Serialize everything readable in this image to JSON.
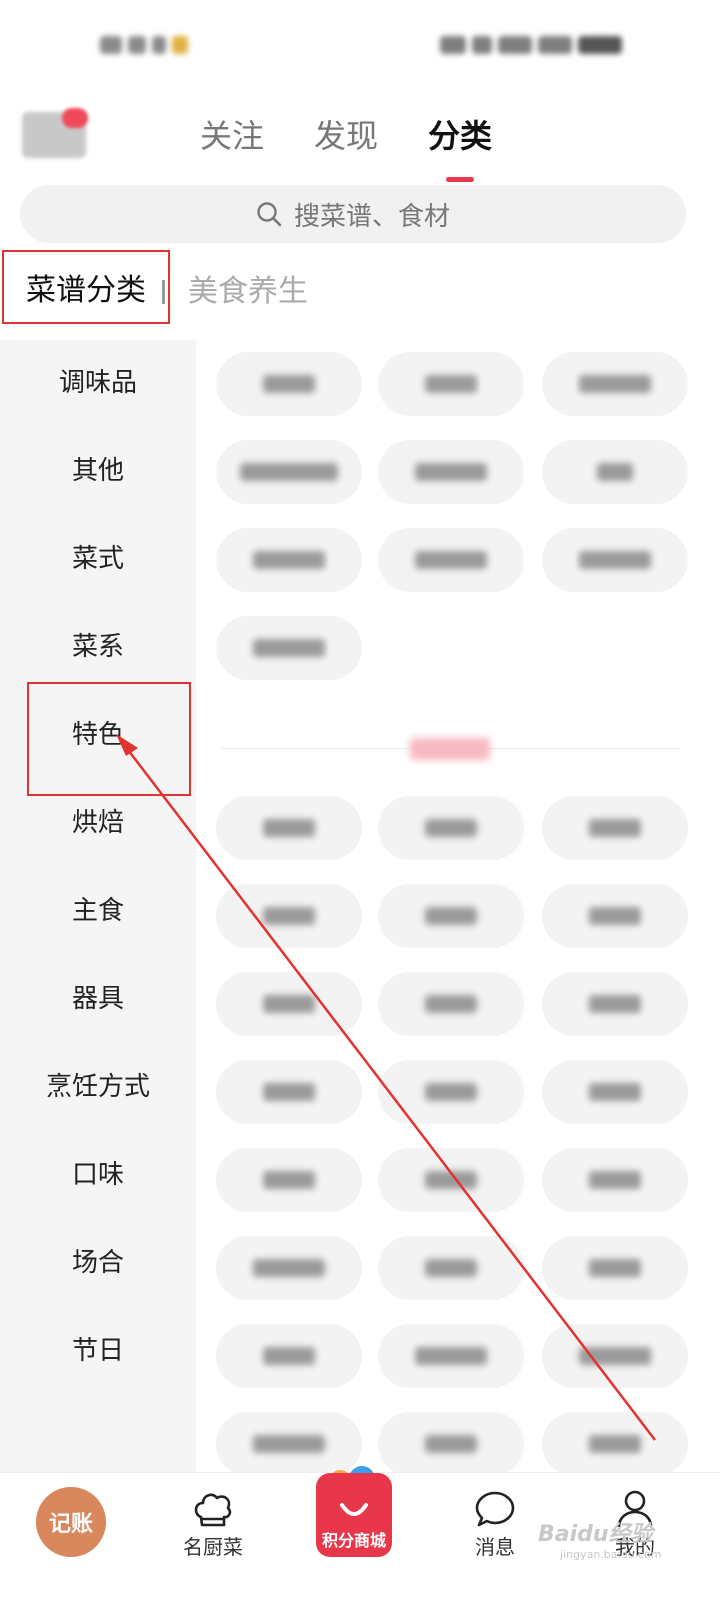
{
  "header": {
    "tabs": [
      {
        "label": "关注",
        "active": false
      },
      {
        "label": "发现",
        "active": false
      },
      {
        "label": "分类",
        "active": true
      }
    ]
  },
  "search": {
    "placeholder": "搜菜谱、食材"
  },
  "section_tabs": [
    {
      "label": "菜谱分类",
      "active": true
    },
    {
      "label": "美食养生",
      "active": false
    }
  ],
  "sidebar": {
    "items": [
      {
        "label": "调味品"
      },
      {
        "label": "其他"
      },
      {
        "label": "菜式"
      },
      {
        "label": "菜系"
      },
      {
        "label": "特色"
      },
      {
        "label": "烘焙"
      },
      {
        "label": "主食"
      },
      {
        "label": "器具"
      },
      {
        "label": "烹饪方式"
      },
      {
        "label": "口味"
      },
      {
        "label": "场合"
      },
      {
        "label": "节日"
      }
    ]
  },
  "bottom_nav": {
    "items": [
      {
        "label": "记账"
      },
      {
        "label": "名厨菜"
      },
      {
        "label": "积分商城"
      },
      {
        "label": "消息"
      },
      {
        "label": "我的"
      }
    ]
  },
  "watermark": {
    "text": "Baidu经验",
    "sub": "jingyan.baidu.com"
  },
  "colors": {
    "accent": "#e8394d",
    "annotation": "#e1332f",
    "bookkeeping": "#d9875d"
  }
}
